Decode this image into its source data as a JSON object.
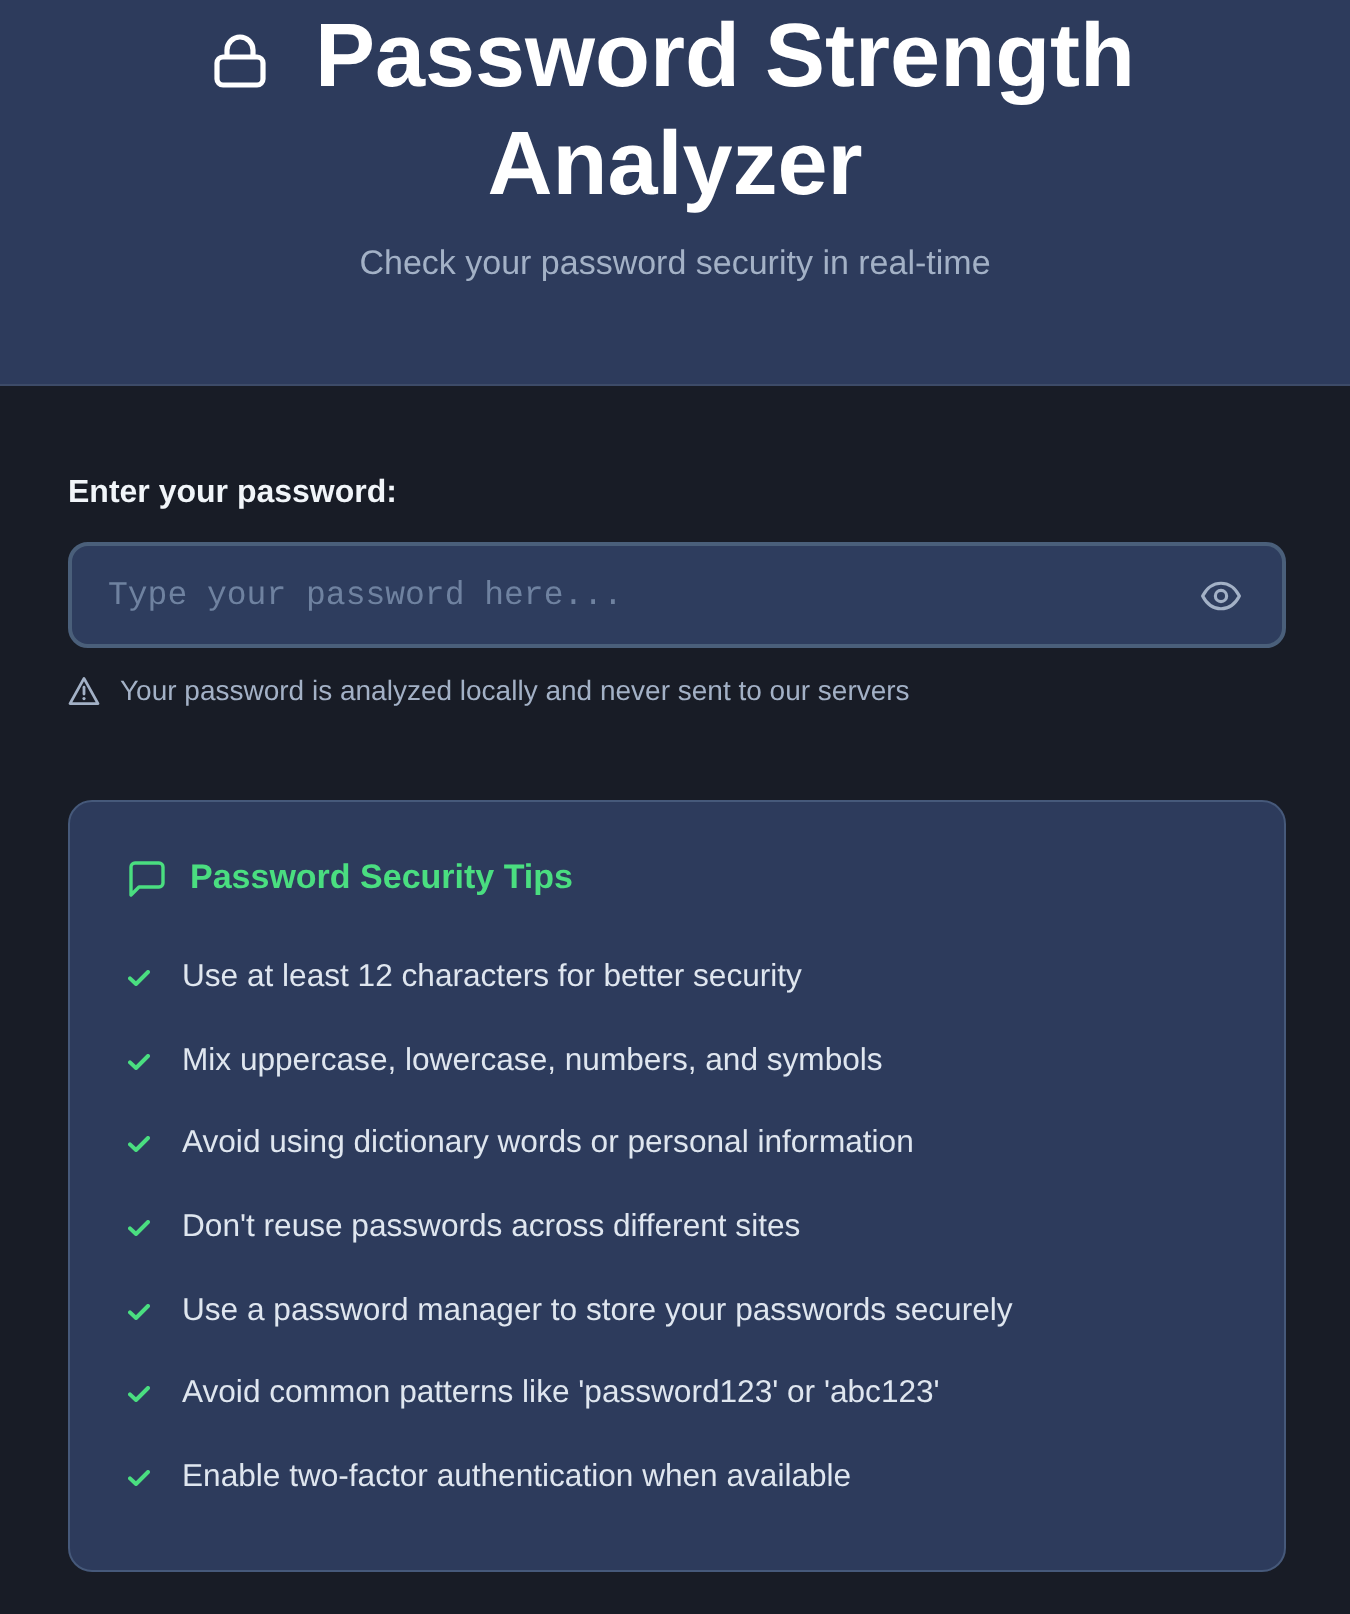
{
  "header": {
    "title": "Password Strength Analyzer",
    "subtitle": "Check your password security in real-time"
  },
  "password": {
    "label": "Enter your password:",
    "placeholder": "Type your password here...",
    "note": "Your password is analyzed locally and never sent to our servers"
  },
  "tips": {
    "title": "Password Security Tips",
    "items": [
      "Use at least 12 characters for better security",
      "Mix uppercase, lowercase, numbers, and symbols",
      "Avoid using dictionary words or personal information",
      "Don't reuse passwords across different sites",
      "Use a password manager to store your passwords securely",
      "Avoid common patterns like 'password123' or 'abc123'",
      "Enable two-factor authentication when available"
    ]
  }
}
